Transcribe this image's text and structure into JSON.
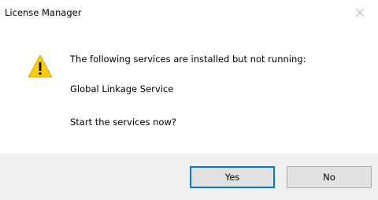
{
  "window": {
    "title": "License Manager",
    "close_icon": "close-icon"
  },
  "message": {
    "icon": "warning-icon",
    "line1": "The following services are installed but not running:",
    "line2": "Global Linkage Service",
    "line3": "Start the services now?"
  },
  "buttons": {
    "yes_label": "Yes",
    "no_label": "No",
    "default": "yes"
  },
  "colors": {
    "warning_fill": "#ffcc00",
    "default_button_border": "#0078d7",
    "footer_background": "#f0f0f0",
    "button_background": "#e1e1e1"
  }
}
